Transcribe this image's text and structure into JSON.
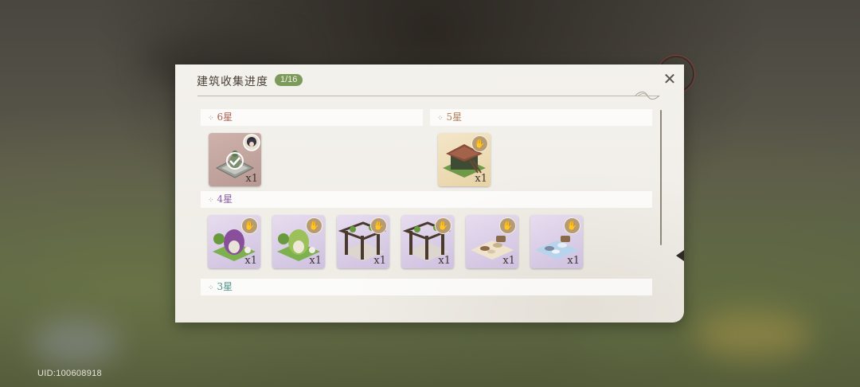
{
  "uid": "UID:100608918",
  "dialog": {
    "title": "建筑收集进度",
    "progress": "1/16",
    "close_glyph": "✕"
  },
  "sections": [
    {
      "label": "6星",
      "items": [
        {
          "qty": "x1",
          "collected": true,
          "icon": "fountain-building-icon"
        }
      ]
    },
    {
      "label": "5星",
      "items": [
        {
          "qty": "x1",
          "collected": false,
          "icon": "tea-pavilion-building-icon"
        }
      ]
    },
    {
      "label": "4星",
      "items": [
        {
          "qty": "x1",
          "collected": false,
          "icon": "leaf-hut-building-icon"
        },
        {
          "qty": "x1",
          "collected": false,
          "icon": "leaf-hut-building-icon"
        },
        {
          "qty": "x1",
          "collected": false,
          "icon": "vine-pergola-building-icon"
        },
        {
          "qty": "x1",
          "collected": false,
          "icon": "vine-pergola-building-icon"
        },
        {
          "qty": "x1",
          "collected": false,
          "icon": "picnic-blanket-building-icon"
        },
        {
          "qty": "x1",
          "collected": false,
          "icon": "picnic-blanket-building-icon"
        }
      ]
    },
    {
      "label": "3星",
      "items": []
    }
  ],
  "colors": {
    "badge": "#7c9a5a",
    "six_star": "#b0604f",
    "five_star": "#b47c55",
    "four_star": "#8a5da6",
    "three_star": "#4d9488"
  }
}
